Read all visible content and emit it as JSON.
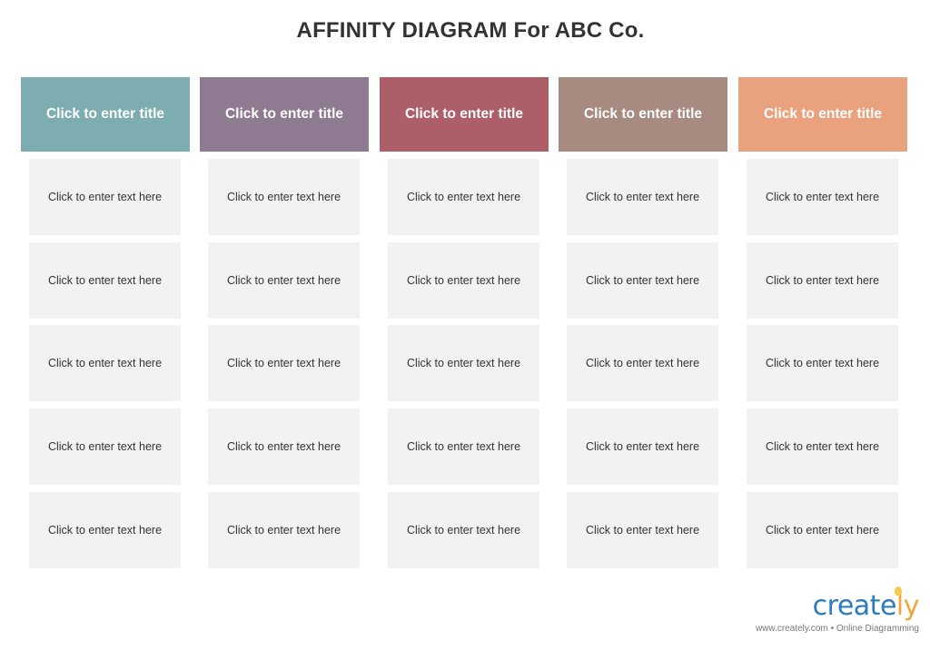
{
  "title": "AFFINITY DIAGRAM For ABC Co.",
  "columns": [
    {
      "header": "Click to enter title",
      "color": "#7eadb1",
      "cards": [
        "Click to enter text here",
        "Click to enter text here",
        "Click to enter text here",
        "Click to enter text here",
        "Click to enter text here"
      ]
    },
    {
      "header": "Click to enter title",
      "color": "#8e7a91",
      "cards": [
        "Click to enter text here",
        "Click to enter text here",
        "Click to enter text here",
        "Click to enter text here",
        "Click to enter text here"
      ]
    },
    {
      "header": "Click to enter title",
      "color": "#ad5f69",
      "cards": [
        "Click to enter text here",
        "Click to enter text here",
        "Click to enter text here",
        "Click to enter text here",
        "Click to enter text here"
      ]
    },
    {
      "header": "Click to enter title",
      "color": "#a78a80",
      "cards": [
        "Click to enter text here",
        "Click to enter text here",
        "Click to enter text here",
        "Click to enter text here",
        "Click to enter text here"
      ]
    },
    {
      "header": "Click to enter title",
      "color": "#e9a17e",
      "cards": [
        "Click to enter text here",
        "Click to enter text here",
        "Click to enter text here",
        "Click to enter text here",
        "Click to enter text here"
      ]
    }
  ],
  "branding": {
    "logo_main": "create",
    "logo_accent": "ly",
    "tagline": "www.creately.com • Online Diagramming"
  }
}
